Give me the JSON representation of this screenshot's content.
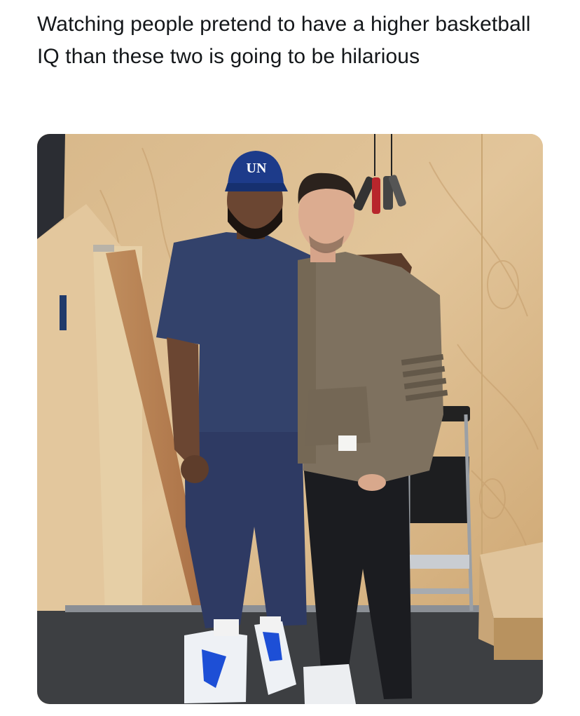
{
  "post": {
    "text": "Watching people pretend to have a higher basketball IQ than these two is going to be hilarious"
  },
  "photo": {
    "cap_logo": "UN"
  },
  "colors": {
    "text": "#14171a",
    "plywood": "#d9b98a",
    "floor": "#3d3f42",
    "navy": "#2f3e66",
    "hoodie": "#7e715f"
  }
}
